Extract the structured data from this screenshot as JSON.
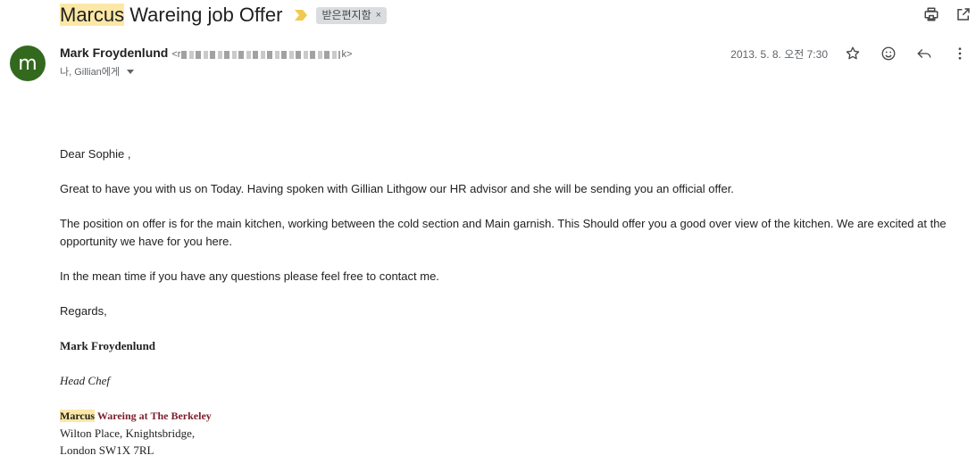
{
  "subject": {
    "highlight": "Marcus",
    "rest": " Wareing job Offer",
    "label": "받은편지함",
    "label_remove": "×"
  },
  "toolbar": {
    "print_icon": "print-icon",
    "open_new_window_icon": "open-in-new-icon"
  },
  "sender": {
    "avatar_letter": "m",
    "name": "Mark Froydenlund",
    "email_prefix": "<r",
    "email_suffix": "k>",
    "recipients": "나, Gillian에게",
    "date": "2013. 5. 8. 오전 7:30"
  },
  "actions": {
    "star_icon": "star-icon",
    "emoji_icon": "emoji-icon",
    "reply_icon": "reply-icon",
    "more_icon": "more-vert-icon"
  },
  "body": {
    "greeting": "Dear Sophie ,",
    "p1": "Great to have you with us on Today. Having spoken with Gillian Lithgow our HR advisor and she will be sending you an official offer.",
    "p2": "The position on offer is for the main kitchen, working between the cold section and Main garnish. This Should offer you a good over view of the kitchen. We are excited at the opportunity we have for you here.",
    "p3": "In the mean time if you have any questions please feel free to contact me.",
    "closing": "Regards,"
  },
  "signature": {
    "name": "Mark Froydenlund",
    "title": "Head Chef",
    "company_highlight": "Marcus",
    "company_rest": " Wareing at The Berkeley",
    "address_line1": "Wilton Place, Knightsbridge,",
    "address_line2": "London SW1X 7RL"
  },
  "colors": {
    "highlight": "#fce8a6",
    "avatar": "#33691e",
    "importance": "#f2c94c",
    "company": "#7b1f2a"
  }
}
